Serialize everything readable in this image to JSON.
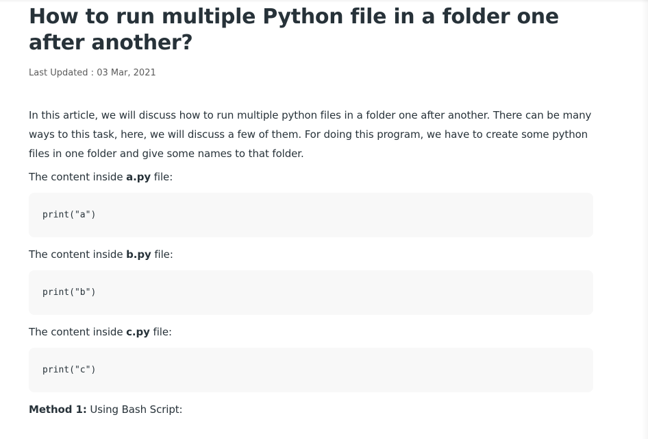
{
  "article": {
    "title": "How to run multiple Python file in a folder one after another?",
    "last_updated": "Last Updated : 03 Mar, 2021",
    "intro": "In this article, we will discuss how to run multiple python files in a folder one after another. There can be many ways to this task, here, we will discuss a few of them. For doing this program, we have to create some python files in one folder and give some names to that folder.",
    "files": [
      {
        "prefix": "The content inside ",
        "filename": "a.py",
        "suffix": " file:",
        "code": "print(\"a\")"
      },
      {
        "prefix": "The content inside ",
        "filename": "b.py",
        "suffix": " file:",
        "code": "print(\"b\")"
      },
      {
        "prefix": "The content inside ",
        "filename": "c.py",
        "suffix": " file:",
        "code": "print(\"c\")"
      }
    ],
    "method": {
      "label": "Method 1:",
      "text": " Using Bash Script:"
    }
  }
}
